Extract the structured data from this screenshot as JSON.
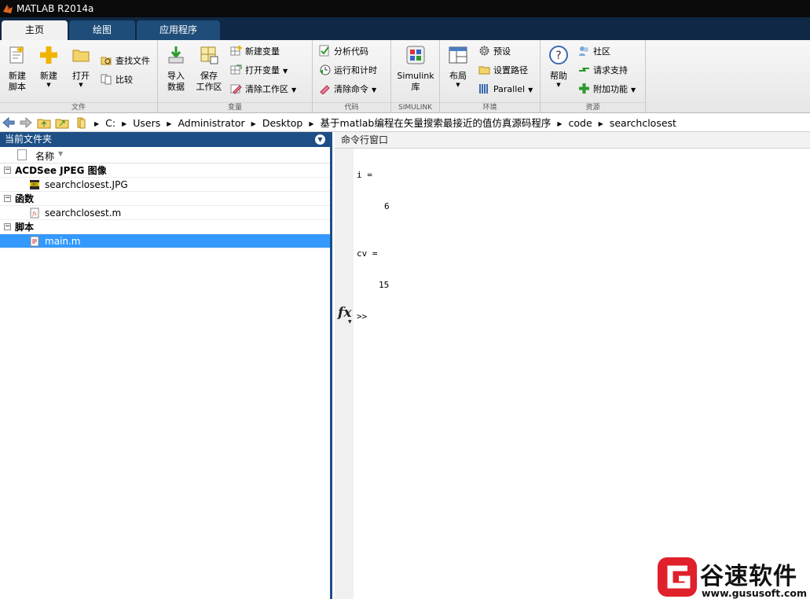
{
  "window": {
    "title": "MATLAB R2014a"
  },
  "tabs": [
    {
      "label": "主页",
      "active": true
    },
    {
      "label": "绘图",
      "active": false
    },
    {
      "label": "应用程序",
      "active": false
    }
  ],
  "ribbon": {
    "file": {
      "label": "文件",
      "new_script": "新建\n脚本",
      "new": "新建",
      "open": "打开",
      "find_files": "查找文件",
      "compare": "比较"
    },
    "variable": {
      "label": "变量",
      "import_data": "导入\n数据",
      "save_workspace": "保存\n工作区",
      "new_variable": "新建变量",
      "open_variable": "打开变量",
      "clear_workspace": "清除工作区"
    },
    "code": {
      "label": "代码",
      "analyze_code": "分析代码",
      "run_and_time": "运行和计时",
      "clear_commands": "清除命令"
    },
    "simulink": {
      "label": "SIMULINK",
      "library": "Simulink\n库"
    },
    "environment": {
      "label": "环境",
      "layout": "布局",
      "preferences": "预设",
      "set_path": "设置路径",
      "parallel": "Parallel"
    },
    "resources": {
      "label": "资源",
      "help": "帮助",
      "community": "社区",
      "request_support": "请求支持",
      "add_ons": "附加功能"
    }
  },
  "path": {
    "crumbs": [
      "C:",
      "Users",
      "Administrator",
      "Desktop",
      "基于matlab编程在矢量搜索最接近的值仿真源码程序",
      "code",
      "searchclosest"
    ]
  },
  "current_folder": {
    "title": "当前文件夹",
    "column_name": "名称",
    "groups": [
      {
        "label": "ACDSee JPEG 图像",
        "files": [
          {
            "name": "searchclosest.JPG",
            "icon": "jpg-file-icon",
            "selected": false
          }
        ]
      },
      {
        "label": "函数",
        "files": [
          {
            "name": "searchclosest.m",
            "icon": "function-file-icon",
            "selected": false
          }
        ]
      },
      {
        "label": "脚本",
        "files": [
          {
            "name": "main.m",
            "icon": "script-file-icon",
            "selected": true
          }
        ]
      }
    ]
  },
  "command_window": {
    "title": "命令行窗口",
    "lines": {
      "var1": "i =",
      "val1": "6",
      "var2": "cv =",
      "val2": "15",
      "prompt": ">>"
    },
    "fx_label": "fx"
  },
  "watermark": {
    "brand": "谷速软件",
    "url": "www.gususoft.com"
  },
  "colors": {
    "panel_header": "#1d4f86",
    "selection": "#3399ff",
    "tabstrip": "#0f2845"
  }
}
